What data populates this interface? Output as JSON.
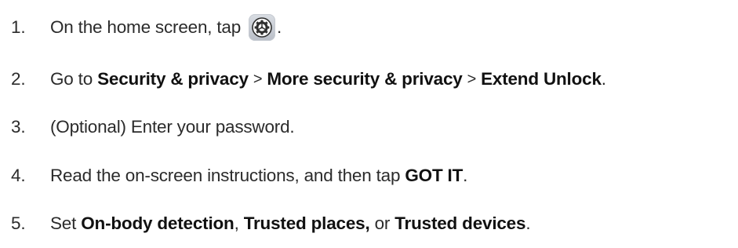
{
  "steps": [
    {
      "number": "1.",
      "text_before": "On the home screen, tap",
      "icon": "settings-gear-icon",
      "text_after": "."
    },
    {
      "number": "2.",
      "text_before": "Go to ",
      "path": [
        "Security & privacy",
        "More security & privacy",
        "Extend Unlock"
      ],
      "separator": ">",
      "text_after": "."
    },
    {
      "number": "3.",
      "text": "(Optional) Enter your password."
    },
    {
      "number": "4.",
      "text_before": "Read the on-screen instructions, and then tap ",
      "bold": "GOT IT",
      "text_after": "."
    },
    {
      "number": "5.",
      "text_before": "Set ",
      "bold_1": "On-body detection",
      "sep_1": ", ",
      "bold_2": "Trusted places,",
      "sep_2": " or ",
      "bold_3": "Trusted devices",
      "text_after": "."
    }
  ]
}
